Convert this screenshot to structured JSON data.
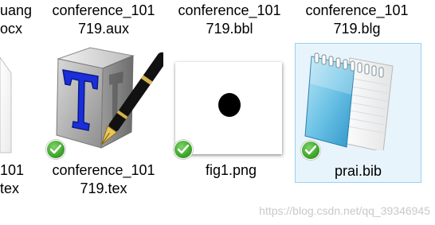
{
  "top_row": [
    {
      "line1": "uang",
      "line2": "ocx"
    },
    {
      "line1": "conference_101",
      "line2": "719.aux"
    },
    {
      "line1": "conference_101",
      "line2": "719.bbl"
    },
    {
      "line1": "conference_101",
      "line2": "719.blg"
    }
  ],
  "files": [
    {
      "line1": "101",
      "line2": "tex",
      "icon": "document-icon",
      "synced": false
    },
    {
      "line1": "conference_101",
      "line2": "719.tex",
      "icon": "texworks-icon",
      "synced": true
    },
    {
      "line1": "fig1.png",
      "icon": "image-thumbnail",
      "synced": true
    },
    {
      "line1": "prai.bib",
      "icon": "notepad-icon",
      "synced": true
    }
  ],
  "watermark": "https://blog.csdn.net/qq_39346945",
  "colors": {
    "selection_bg": "#e8f4fb",
    "selection_border": "#99d1f0",
    "sync_badge": "#3fa52b"
  }
}
